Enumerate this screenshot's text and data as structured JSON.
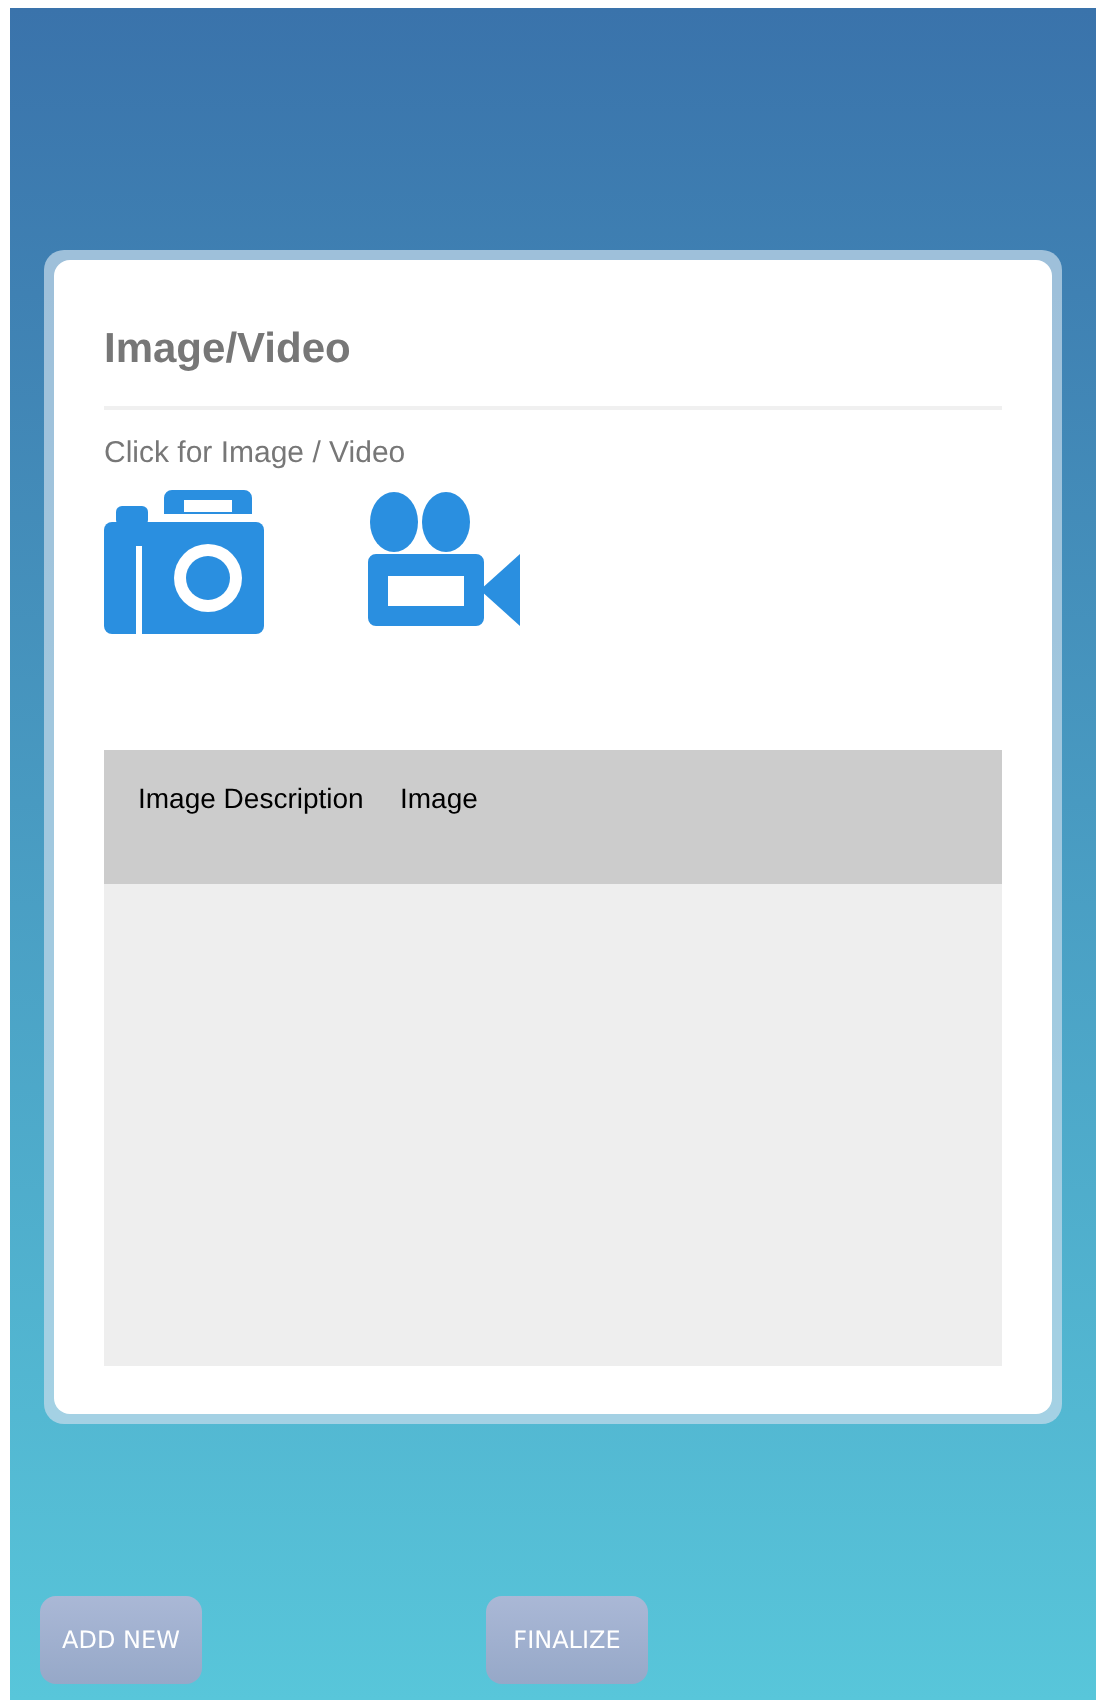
{
  "card": {
    "title": "Image/Video",
    "subtitle": "Click for Image / Video"
  },
  "table": {
    "columns": [
      "Image Description",
      "Image"
    ]
  },
  "buttons": [
    "ADD NEW",
    "FINALIZE"
  ]
}
